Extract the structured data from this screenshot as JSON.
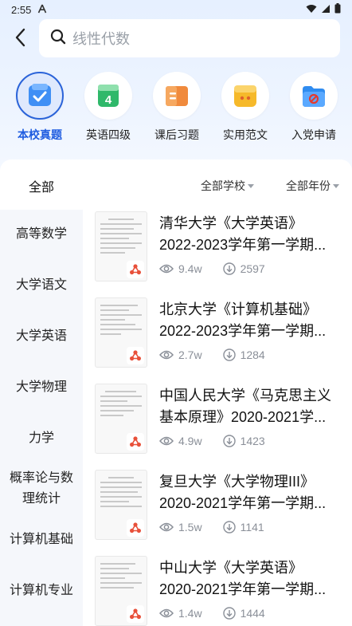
{
  "status": {
    "time": "2:55"
  },
  "search": {
    "placeholder": "线性代数"
  },
  "categories": [
    {
      "label": "本校真题",
      "icon": "exam-paper-icon",
      "active": true
    },
    {
      "label": "英语四级",
      "icon": "cet4-book-icon",
      "active": false
    },
    {
      "label": "课后习题",
      "icon": "exercise-book-icon",
      "active": false
    },
    {
      "label": "实用范文",
      "icon": "sample-essay-icon",
      "active": false
    },
    {
      "label": "入党申请",
      "icon": "party-folder-icon",
      "active": false
    }
  ],
  "filters": {
    "all_tab": "全部",
    "school": "全部学校",
    "year": "全部年份"
  },
  "sidebar": {
    "items": [
      {
        "label": "高等数学"
      },
      {
        "label": "大学语文"
      },
      {
        "label": "大学英语"
      },
      {
        "label": "大学物理"
      },
      {
        "label": "力学"
      },
      {
        "label": "概率论与数理统计",
        "line1": "概率论与数",
        "line2": "理统计"
      },
      {
        "label": "计算机基础"
      },
      {
        "label": "计算机专业"
      }
    ]
  },
  "documents": [
    {
      "line1": "清华大学《大学英语》",
      "line2": "2022-2023学年第一学期...",
      "views": "9.4w",
      "downloads": "2597"
    },
    {
      "line1": "北京大学《计算机基础》",
      "line2": "2022-2023学年第一学期...",
      "views": "2.7w",
      "downloads": "1284"
    },
    {
      "line1": "中国人民大学《马克思主义",
      "line2": "基本原理》2020-2021学...",
      "views": "4.9w",
      "downloads": "1423"
    },
    {
      "line1": "复旦大学《大学物理III》",
      "line2": "2020-2021学年第一学期...",
      "views": "1.5w",
      "downloads": "1141"
    },
    {
      "line1": "中山大学《大学英语》",
      "line2": "2020-2021学年第一学期...",
      "views": "1.4w",
      "downloads": "1444"
    }
  ],
  "colors": {
    "accent": "#1f5ce0",
    "pdf": "#e8503a"
  }
}
